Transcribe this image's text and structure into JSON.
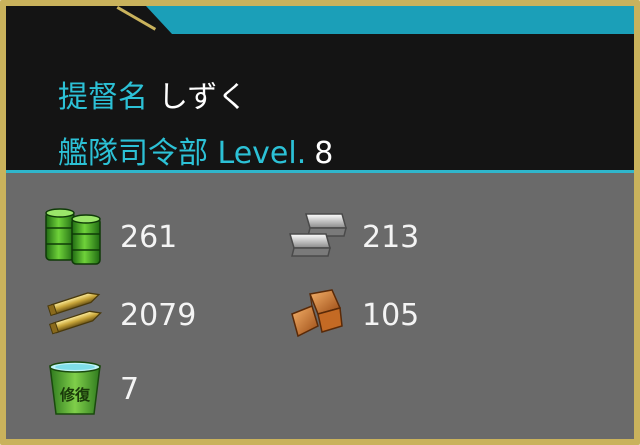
{
  "admiral": {
    "name_label": "提督名",
    "name": "しずく",
    "hq_label": "艦隊司令部 Level.",
    "hq_level": "8"
  },
  "resources": {
    "fuel": {
      "icon": "fuel-drums-icon",
      "value": "261"
    },
    "steel": {
      "icon": "steel-ingots-icon",
      "value": "213"
    },
    "ammo": {
      "icon": "ammo-bullets-icon",
      "value": "2079"
    },
    "bauxite": {
      "icon": "bauxite-ore-icon",
      "value": "105"
    },
    "bucket": {
      "icon": "repair-bucket-icon",
      "value": "7",
      "label": "修復"
    }
  },
  "colors": {
    "accent": "#2cc1d6",
    "border": "#c9b25c",
    "header_bg": "#141414",
    "panel_bg": "#6a6a6a"
  }
}
